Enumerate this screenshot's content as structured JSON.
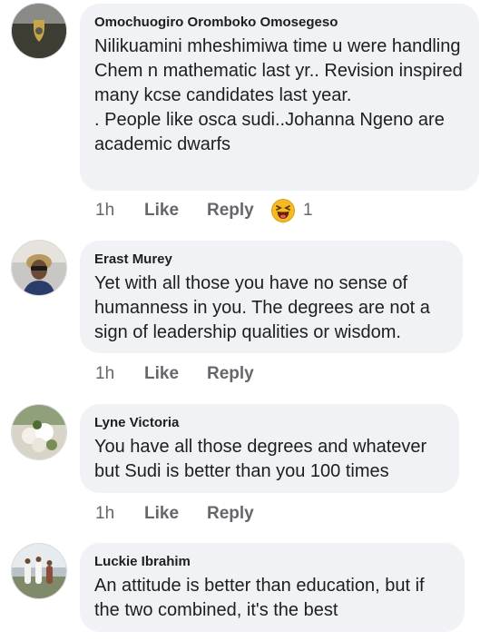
{
  "comments": [
    {
      "author": "Omochuogiro Oromboko Omosegeso",
      "text": "Nilikuamini mheshimiwa time u were handling Chem n mathematic last yr.. Revision inspired many kcse candidates last year.\n. People like osca sudi..Johanna Ngeno are academic dwarfs",
      "time": "1h",
      "like": "Like",
      "reply": "Reply",
      "reaction_icon": "haha-emoji-icon",
      "reaction_count": "1"
    },
    {
      "author": "Erast Murey",
      "text": "Yet with all those you have no sense of humanness in you. The degrees are not a sign of leadership qualities or wisdom.",
      "time": "1h",
      "like": "Like",
      "reply": "Reply"
    },
    {
      "author": "Lyne Victoria",
      "text": "You have all those degrees and whatever but Sudi is better than you 100 times",
      "time": "1h",
      "like": "Like",
      "reply": "Reply"
    },
    {
      "author": "Luckie Ibrahim",
      "text": "An attitude is better than education, but if the two  combined, it's the best"
    }
  ],
  "colors": {
    "bubble": "#f0f2f5",
    "meta_text": "#65676b",
    "haha_yellow": "#f7b928"
  }
}
